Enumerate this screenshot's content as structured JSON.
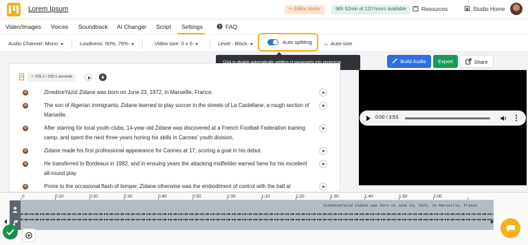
{
  "header": {
    "title": "Lorem Ipsum",
    "editor_mode": "✏ Editor Mode",
    "hours_available": "96h 52min of 120 hours available",
    "resources": "Resources",
    "studio_home": "Studio Home"
  },
  "tabs": [
    "Video/Images",
    "Voices",
    "Soundtrack",
    "AI Changer",
    "Script",
    "Settings",
    "FAQ"
  ],
  "active_tab": "Settings",
  "toolbar": {
    "audio_channel": "Audio Channel: Mono",
    "loudness": "Loudness: 50%, 78%",
    "video_size": "Video size: 0 x 0",
    "level": "Level - Block",
    "auto_splitting": "Auto splitting",
    "auto_splitting_on": true,
    "auto_size": "Auto-size"
  },
  "tooltip": "Click to disable automatically splitting of paragraphs into sentences.",
  "script": {
    "duration_badge": "225.1 / 225.1 seconds",
    "paragraphs": [
      "ZinedineYazid Zidane was born on June 23, 1972, in Marseille, France.",
      "The son of Algerian immigrants, Zidane learned to play soccer in the streets of La Castellane, a rough section of Marseille.",
      "After starring for local youth clubs, 14-year-old Zidane was discovered at a French Football Federation training camp, and spent the next three years honing his skills in Cannes' youth division.",
      "Zidane made his first professional appearance for Cannes at 17, scoring a goal in his debut.",
      "He transferred to Bordeaux in 1992, and in ensuing years the attacking midfielder earned fame for his excellent all-round play.",
      "Prone to the occasional flash of temper, Zidane otherwise was the embodiment of control with the ball at"
    ]
  },
  "actions": {
    "build_audio": "Build Audio",
    "export": "Export",
    "share": "Share"
  },
  "player": {
    "time": "0:00 / 3:53"
  },
  "timeline": {
    "ticks": [
      "0",
      "0:10",
      "0:20",
      "0:30",
      "0:40",
      "0:50",
      "1:00",
      "1:10",
      "1:20",
      "1:30",
      "1:40",
      "1:50",
      "2:00"
    ],
    "caption": "ZinedineYazid Zidane was born on June 23, 1972, in Marseille, France"
  },
  "colors": {
    "accent": "#f6b21a",
    "primary_blue": "#2f6fe0",
    "export_green": "#1a9a57",
    "track_gray": "#b3bcc3"
  },
  "icons": [
    "logo-icon",
    "resources-icon",
    "home-icon",
    "faq-icon",
    "wand-icon",
    "share-icon",
    "chat-icon",
    "check-icon",
    "plus-icon",
    "person-icon",
    "music-icon"
  ]
}
